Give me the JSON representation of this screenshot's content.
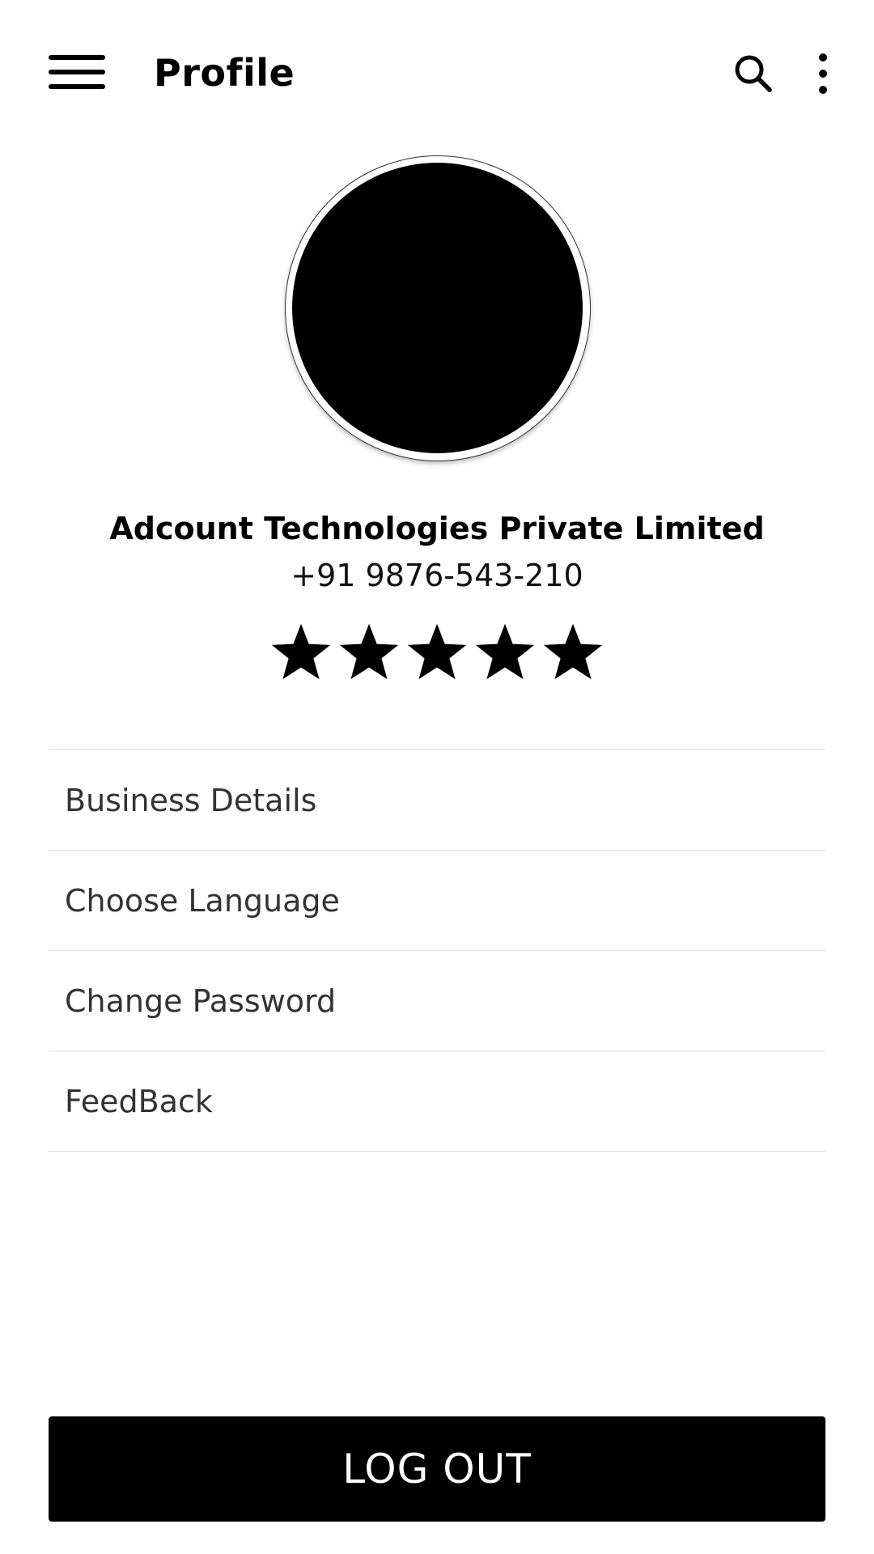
{
  "appbar": {
    "title": "Profile",
    "menu_icon": "hamburger-menu-icon",
    "search_icon": "search-icon",
    "more_icon": "more-vertical-icon"
  },
  "profile": {
    "avatar": "avatar",
    "business_name": "Adcount Technologies Private Limited",
    "phone": "+91 9876-543-210",
    "rating": {
      "value": 5,
      "max": 5,
      "icon": "star-icon"
    }
  },
  "menu": {
    "items": [
      {
        "label": "Business Details"
      },
      {
        "label": "Choose Language"
      },
      {
        "label": "Change Password"
      },
      {
        "label": "FeedBack"
      }
    ]
  },
  "logout": {
    "label": "LOG OUT"
  },
  "colors": {
    "primary": "#000000",
    "background": "#ffffff",
    "divider": "#dcdcdc",
    "menu_text": "#333333",
    "button_text": "#ffffff"
  }
}
